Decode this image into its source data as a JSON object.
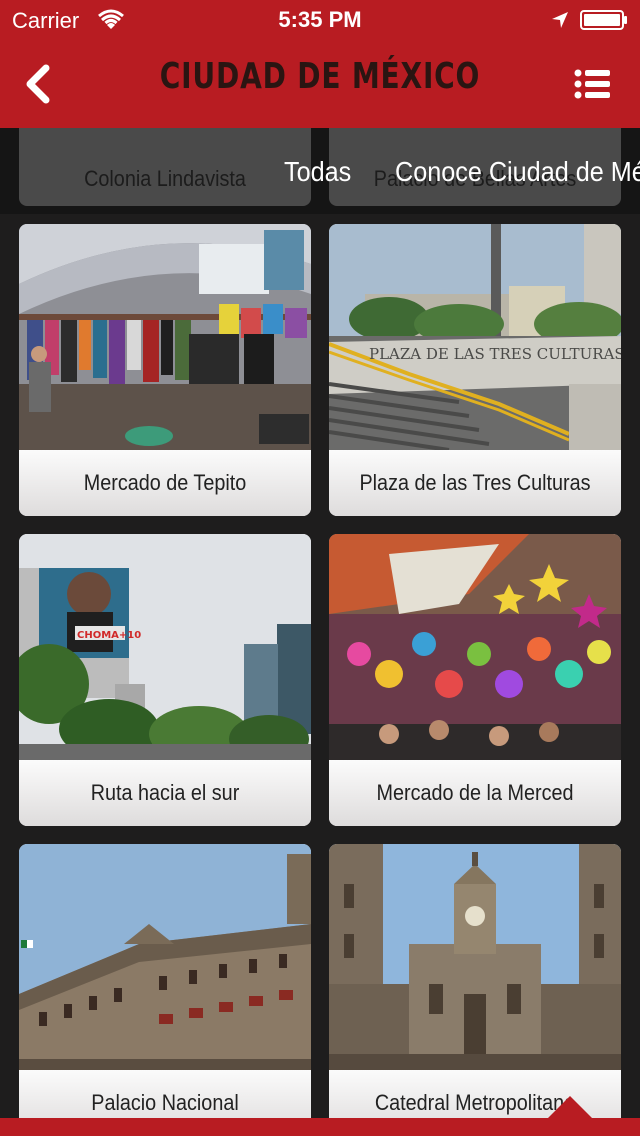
{
  "status_bar": {
    "carrier": "Carrier",
    "time": "5:35 PM"
  },
  "nav": {
    "title": "CIUDAD DE MÉXICO",
    "back_icon": "chevron-left-icon",
    "menu_icon": "list-menu-icon"
  },
  "filter_strip": {
    "ghost_cards": [
      "Colonia Lindavista",
      "Palacio de Bellas Artes"
    ],
    "tabs": [
      "Todas",
      "Conoce Ciudad de México"
    ]
  },
  "cards": [
    {
      "label": "Mercado de Tepito"
    },
    {
      "label": "Plaza de las Tres Culturas"
    },
    {
      "label": "Ruta hacia el sur"
    },
    {
      "label": "Mercado de la Merced"
    },
    {
      "label": "Palacio Nacional"
    },
    {
      "label": "Catedral Metropolitana"
    }
  ],
  "photo_text": {
    "plaza_sign": "PLAZA DE LAS TRES CULTURAS",
    "billboard": "CHOMA+10"
  },
  "colors": {
    "brand_red": "#b81c22",
    "title_text": "#2a1512",
    "background": "#1e1d1d"
  }
}
